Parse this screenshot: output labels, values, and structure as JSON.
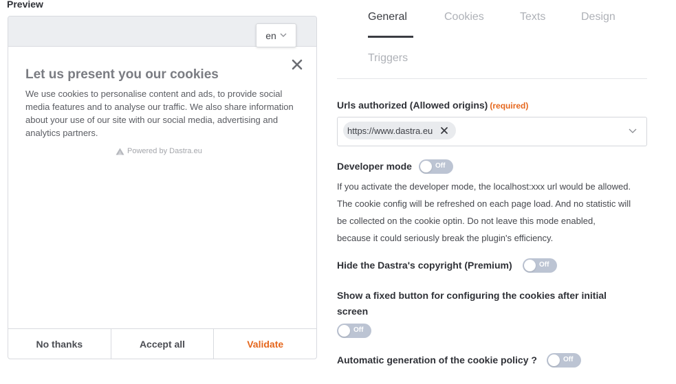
{
  "preview": {
    "heading": "Preview",
    "language": "en",
    "banner": {
      "title": "Let us present you our cookies",
      "text": "We use cookies to personalise content and ads, to provide social media features and to analyse our traffic. We also share information about your use of our site with our social media, advertising and analytics partners.",
      "powered_by": "Powered by Dastra.eu",
      "buttons": {
        "no_thanks": "No thanks",
        "accept_all": "Accept all",
        "validate": "Validate"
      }
    }
  },
  "tabs": [
    {
      "label": "General",
      "active": true
    },
    {
      "label": "Cookies",
      "active": false
    },
    {
      "label": "Texts",
      "active": false
    },
    {
      "label": "Design",
      "active": false
    },
    {
      "label": "Triggers",
      "active": false
    }
  ],
  "settings": {
    "urls": {
      "label": "Urls authorized (Allowed origins)",
      "required": "(required)",
      "values": [
        "https://www.dastra.eu"
      ]
    },
    "developer_mode": {
      "label": "Developer mode",
      "toggle": "Off",
      "help_lines": [
        "If you activate the developer mode, the localhost:xxx url would be allowed.",
        "The cookie config will be refreshed on each page load. And no statistic will",
        "be collected on the cookie optin. Do not leave this mode enabled,",
        "because it could seriously break the plugin's efficiency."
      ]
    },
    "hide_copyright": {
      "label": "Hide the Dastra's copyright (Premium)",
      "toggle": "Off"
    },
    "fixed_button": {
      "label_line1": "Show a fixed button for configuring the cookies after initial",
      "label_line2": "screen",
      "toggle": "Off"
    },
    "auto_policy": {
      "label": "Automatic generation of the cookie policy ?",
      "toggle": "Off"
    }
  },
  "colors": {
    "accent": "#e5661c",
    "toggle_off": "#bcc4d3",
    "tab_active": "#3a3c42",
    "tab_inactive": "#aeb1b7"
  }
}
